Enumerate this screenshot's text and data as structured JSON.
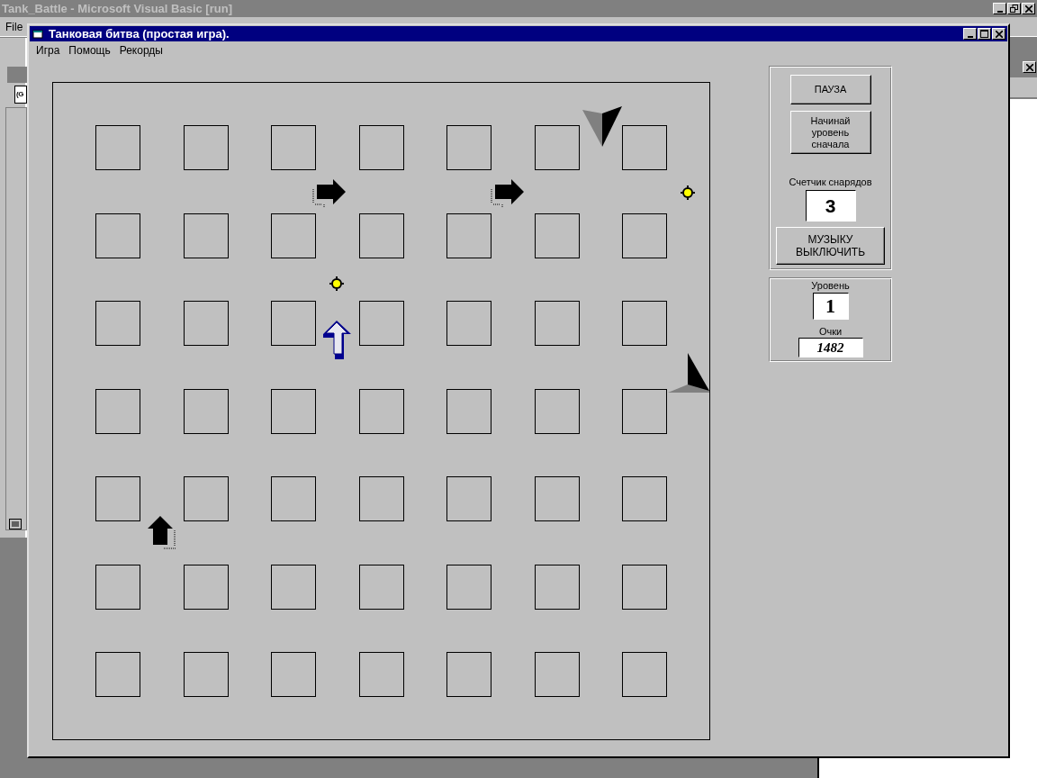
{
  "ide": {
    "title": "Tank_Battle - Microsoft Visual Basic [run]",
    "menu": [
      "File"
    ],
    "combo_value": "(G"
  },
  "window": {
    "title": "Танковая битва (простая игра).",
    "menu": [
      "Игра",
      "Помощь",
      "Рекорды"
    ]
  },
  "panel": {
    "pause_button": "ПАУЗА",
    "restart_button": "Начинай\nуровень\nсначала",
    "shells_label": "Счетчик снарядов",
    "shells_value": "3",
    "music_button": "МУЗЫКУ\nВЫКЛЮЧИТЬ"
  },
  "stats": {
    "level_label": "Уровень",
    "level_value": "1",
    "score_label": "Очки",
    "score_value": "1482"
  }
}
